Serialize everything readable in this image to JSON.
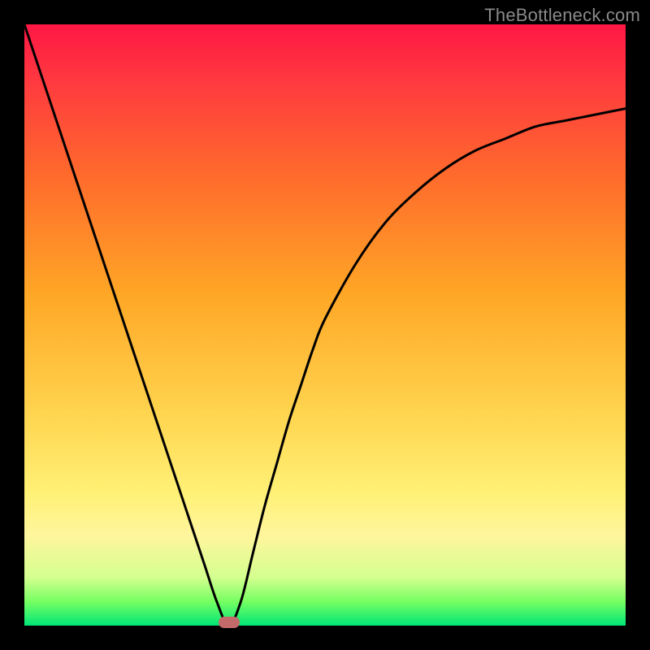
{
  "watermark": "TheBottleneck.com",
  "colors": {
    "frame": "#000000",
    "curve": "#000000",
    "marker": "#c56a6a",
    "gradient_top": "#ff1744",
    "gradient_bottom": "#00e676"
  },
  "chart_data": {
    "type": "line",
    "title": "",
    "xlabel": "",
    "ylabel": "",
    "xlim": [
      0,
      100
    ],
    "ylim": [
      0,
      100
    ],
    "x": [
      0,
      2,
      4,
      6,
      8,
      10,
      12,
      14,
      16,
      18,
      20,
      22,
      24,
      26,
      28,
      30,
      32,
      34,
      36,
      38,
      40,
      42,
      44,
      46,
      48,
      50,
      55,
      60,
      65,
      70,
      75,
      80,
      85,
      90,
      95,
      100
    ],
    "values": [
      100,
      94,
      88,
      82,
      76,
      70,
      64,
      58,
      52,
      46,
      40,
      34,
      28,
      22,
      16,
      10,
      4,
      0,
      4,
      12,
      20,
      27,
      34,
      40,
      46,
      51,
      60,
      67,
      72,
      76,
      79,
      81,
      83,
      84,
      85,
      86
    ],
    "minimum": {
      "x": 34,
      "y": 0
    },
    "marker": {
      "x": 34,
      "y": 0
    }
  }
}
